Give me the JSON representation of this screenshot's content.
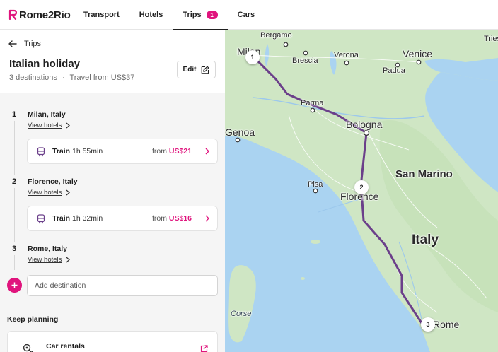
{
  "brand": {
    "name": "Rome2Rio",
    "accent": "#e0147d"
  },
  "nav": {
    "items": [
      {
        "label": "Transport"
      },
      {
        "label": "Hotels"
      },
      {
        "label": "Trips",
        "badge": "1"
      },
      {
        "label": "Cars"
      }
    ]
  },
  "trip": {
    "back_label": "Trips",
    "title": "Italian holiday",
    "destinations_count": "3 destinations",
    "separator": "·",
    "travel_from": "Travel from US$37",
    "edit_label": "Edit"
  },
  "stops": [
    {
      "number": "1",
      "name": "Milan, Italy",
      "link": "View hotels"
    },
    {
      "number": "2",
      "name": "Florence, Italy",
      "link": "View hotels"
    },
    {
      "number": "3",
      "name": "Rome, Italy",
      "link": "View hotels"
    }
  ],
  "legs": [
    {
      "mode": "Train",
      "duration": "1h 55min",
      "from_label": "from",
      "price": "US$21"
    },
    {
      "mode": "Train",
      "duration": "1h 32min",
      "from_label": "from",
      "price": "US$16"
    }
  ],
  "add_destination": {
    "placeholder": "Add destination"
  },
  "keep_planning": {
    "title": "Keep planning",
    "items": [
      {
        "label": "Car rentals",
        "icon": "car-key-icon"
      }
    ]
  },
  "map": {
    "labels": {
      "bergamo": "Bergamo",
      "milan": "Milan",
      "brescia": "Brescia",
      "verona": "Verona",
      "venice": "Venice",
      "padua": "Padua",
      "trieste": "Trieste",
      "parma": "Parma",
      "bologna": "Bologna",
      "genoa": "Genoa",
      "san_marino": "San Marino",
      "pisa": "Pisa",
      "florence": "Florence",
      "italy": "Italy",
      "corse": "Corse",
      "rome": "Rome"
    },
    "markers": [
      "1",
      "2",
      "3"
    ],
    "colors": {
      "land": "#cfe6c4",
      "sea": "#aad3f1",
      "route": "#6b3f8a"
    }
  }
}
